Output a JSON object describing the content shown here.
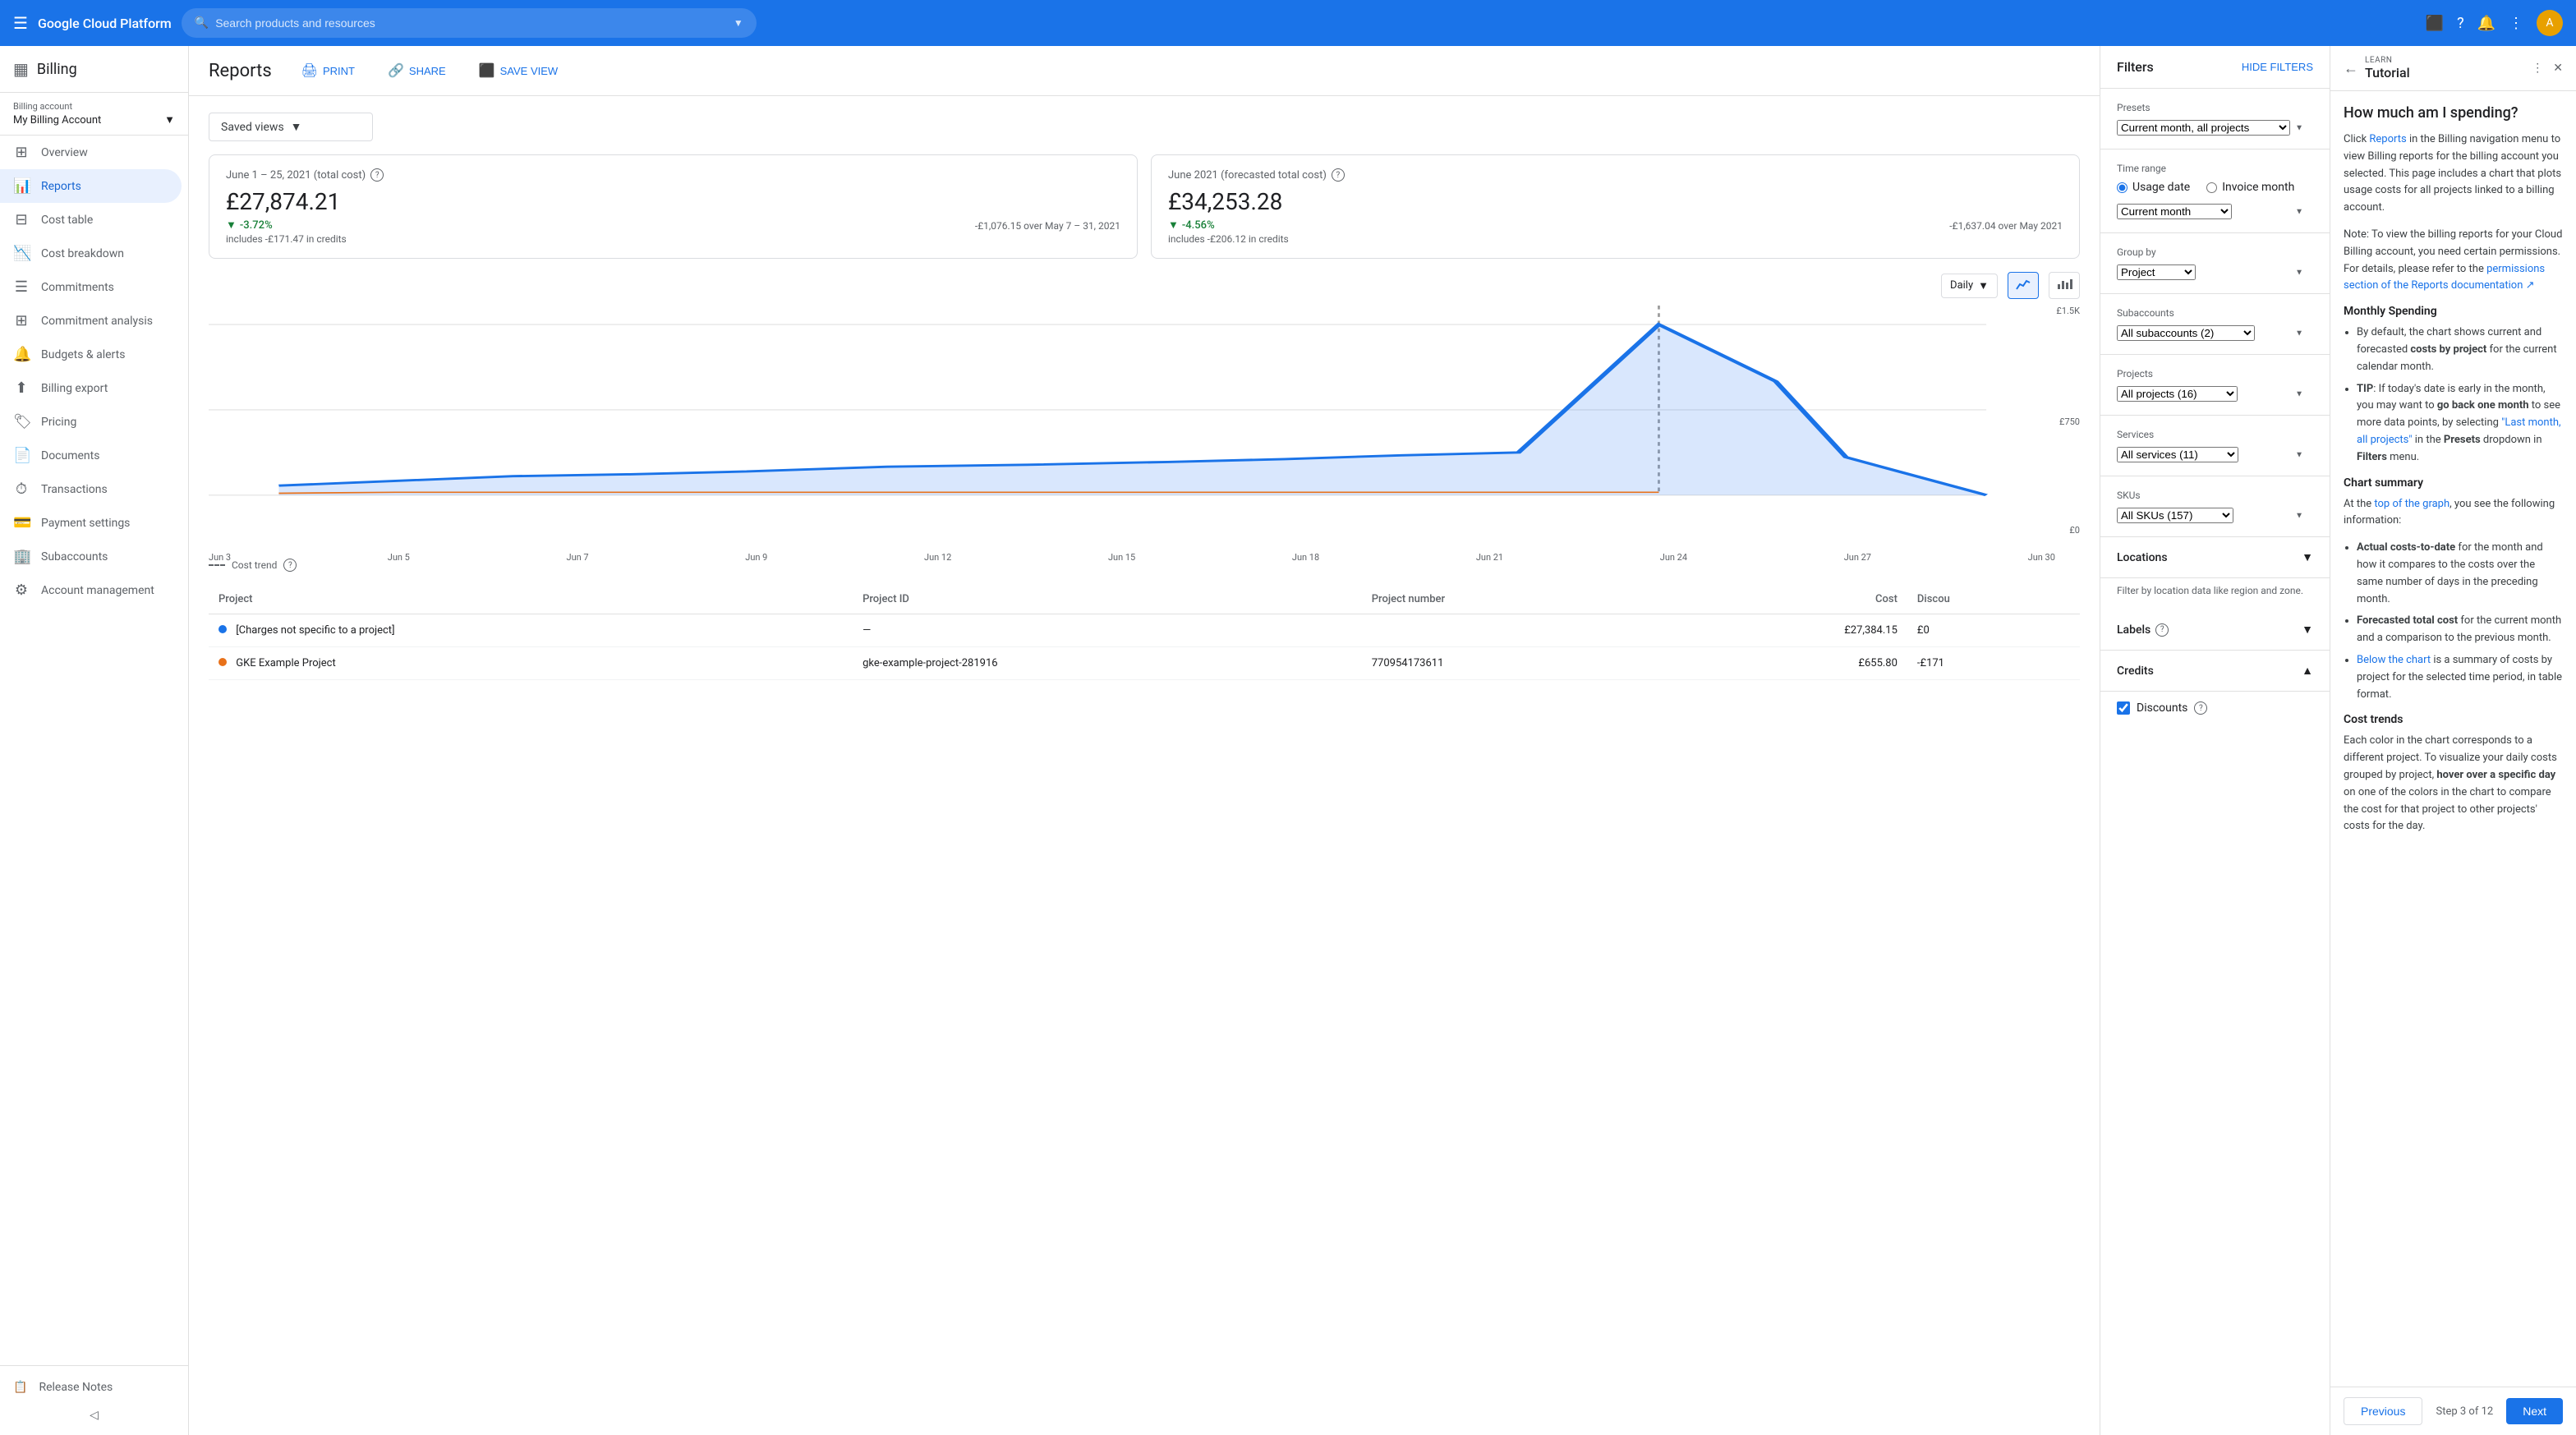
{
  "topnav": {
    "brand": "Google Cloud Platform",
    "search_placeholder": "Search products and resources"
  },
  "sidebar": {
    "billing_icon": "▦",
    "billing_title": "Billing",
    "account_label": "Billing account",
    "account_name": "My Billing Account",
    "nav_items": [
      {
        "id": "overview",
        "label": "Overview",
        "icon": "⊞"
      },
      {
        "id": "reports",
        "label": "Reports",
        "icon": "📊",
        "active": true
      },
      {
        "id": "cost-table",
        "label": "Cost table",
        "icon": "⊟"
      },
      {
        "id": "cost-breakdown",
        "label": "Cost breakdown",
        "icon": "📉"
      },
      {
        "id": "commitments",
        "label": "Commitments",
        "icon": "☰"
      },
      {
        "id": "commitment-analysis",
        "label": "Commitment analysis",
        "icon": "⊞"
      },
      {
        "id": "budgets-alerts",
        "label": "Budgets & alerts",
        "icon": "🔔"
      },
      {
        "id": "billing-export",
        "label": "Billing export",
        "icon": "⬆"
      },
      {
        "id": "pricing",
        "label": "Pricing",
        "icon": "🏷"
      },
      {
        "id": "documents",
        "label": "Documents",
        "icon": "📄"
      },
      {
        "id": "transactions",
        "label": "Transactions",
        "icon": "⏱"
      },
      {
        "id": "payment-settings",
        "label": "Payment settings",
        "icon": "💳"
      },
      {
        "id": "subaccounts",
        "label": "Subaccounts",
        "icon": "🏢"
      },
      {
        "id": "account-management",
        "label": "Account management",
        "icon": "⚙"
      }
    ],
    "release_notes": "Release Notes"
  },
  "page": {
    "title": "Reports",
    "print_btn": "PRINT",
    "share_btn": "SHARE",
    "save_view_btn": "SAVE VIEW"
  },
  "saved_views": {
    "label": "Saved views"
  },
  "stats": {
    "left": {
      "title": "June 1 – 25, 2021 (total cost)",
      "amount": "£27,874.21",
      "change": "-3.72%",
      "sub1": "includes -£171.47 in credits",
      "sub2": "-£1,076.15 over May 7 – 31, 2021"
    },
    "right": {
      "title": "June 2021 (forecasted total cost)",
      "amount": "£34,253.28",
      "change": "-4.56%",
      "sub1": "includes -£206.12 in credits",
      "sub2": "-£1,637.04 over May 2021"
    }
  },
  "chart": {
    "view_label": "Daily",
    "y_labels": [
      "£1.5K",
      "£750",
      "£0"
    ],
    "x_labels": [
      "Jun 3",
      "Jun 5",
      "Jun 7",
      "Jun 9",
      "Jun 12",
      "Jun 15",
      "Jun 18",
      "Jun 21",
      "Jun 24",
      "Jun 27",
      "Jun 30"
    ],
    "legend_label": "Cost trend"
  },
  "table": {
    "headers": [
      "Project",
      "Project ID",
      "Project number",
      "Cost",
      "Discou"
    ],
    "rows": [
      {
        "dot_color": "#1a73e8",
        "project": "[Charges not specific to a project]",
        "project_id": "—",
        "project_number": "",
        "cost": "£27,384.15",
        "discount": "£0"
      },
      {
        "dot_color": "#e8711a",
        "project": "GKE Example Project",
        "project_id": "gke-example-project-281916",
        "project_number": "770954173611",
        "cost": "£655.80",
        "discount": "-£171"
      }
    ]
  },
  "filters": {
    "title": "Filters",
    "hide_btn": "HIDE FILTERS",
    "presets_label": "Presets",
    "presets_value": "Current month, all projects",
    "time_range_label": "Time range",
    "radio_usage": "Usage date",
    "radio_invoice": "Invoice month",
    "current_month": "Current month",
    "group_by_label": "Group by",
    "group_by_value": "Project",
    "subaccounts_label": "Subaccounts",
    "subaccounts_value": "All subaccounts (2)",
    "projects_label": "Projects",
    "projects_value": "All projects (16)",
    "services_label": "Services",
    "services_value": "All services (11)",
    "skus_label": "SKUs",
    "skus_value": "All SKUs (157)",
    "locations_label": "Locations",
    "locations_sub": "Filter by location data like region and zone.",
    "labels_label": "Labels",
    "credits_label": "Credits",
    "discounts_label": "Discounts",
    "discounts_checked": true
  },
  "tutorial": {
    "learn_label": "LEARN",
    "title": "Tutorial",
    "main_title": "How much am I spending?",
    "intro": "Click Reports in the Billing navigation menu to view Billing reports for the billing account you selected. This page includes a chart that plots usage costs for all projects linked to a billing account.",
    "note": "Note: To view the billing reports for your Cloud Billing account, you need certain permissions. For details, please refer to the permissions section of the Reports documentation.",
    "monthly_title": "Monthly Spending",
    "monthly_items": [
      "By default, the chart shows current and forecasted costs by project for the current calendar month.",
      "TIP: If today's date is early in the month, you may want to go back one month to see more data points, by selecting \"Last month, all projects\" in the Presets dropdown in Filters menu."
    ],
    "chart_summary_title": "Chart summary",
    "chart_summary_intro": "At the top of the graph, you see the following information:",
    "chart_summary_items": [
      "Actual costs-to-date for the month and how it compares to the costs over the same number of days in the preceding month.",
      "Forecasted total cost for the current month and a comparison to the previous month.",
      "Below the chart is a summary of costs by project for the selected time period, in table format."
    ],
    "cost_trends_title": "Cost trends",
    "cost_trends_text": "Each color in the chart corresponds to a different project. To visualize your daily costs grouped by project, hover over a specific day on one of the colors in the chart to compare the cost for that project to other projects' costs for the day.",
    "footer_prev": "Previous",
    "footer_step": "Step 3 of 12",
    "footer_next": "Next"
  }
}
